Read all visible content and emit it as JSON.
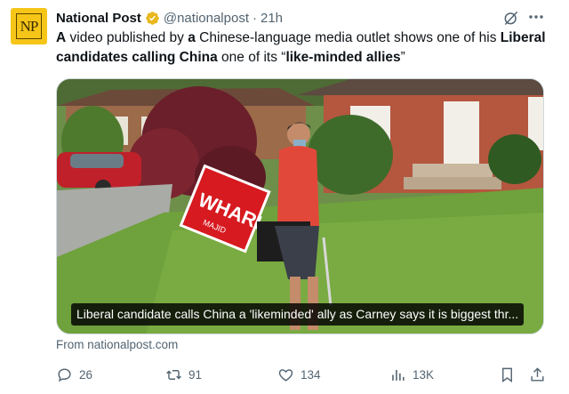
{
  "tweet": {
    "author": {
      "name": "National Post",
      "handle": "@nationalpost",
      "time": "21h",
      "avatar_text": "NP",
      "verified_color": "#e8b71a"
    },
    "text_parts": [
      {
        "t": "A",
        "bold": true
      },
      {
        "t": " video published by ",
        "bold": false
      },
      {
        "t": "a",
        "bold": true
      },
      {
        "t": " Chinese-language media outlet shows one of his ",
        "bold": false
      },
      {
        "t": "Liberal candidates calling China",
        "bold": true
      },
      {
        "t": " one of its “",
        "bold": false
      },
      {
        "t": "like-minded allies",
        "bold": true
      },
      {
        "t": "”",
        "bold": false
      }
    ],
    "media": {
      "caption": "Liberal candidate calls China a 'likeminded' ally as Carney says it is biggest thr...",
      "sign_text": "WHARI",
      "sign_subtext": "MAJID"
    },
    "source": "From nationalpost.com",
    "actions": {
      "replies": "26",
      "retweets": "91",
      "likes": "134",
      "views": "13K"
    },
    "icons": [
      "verified-icon",
      "grok-icon",
      "more-icon",
      "reply-icon",
      "retweet-icon",
      "like-icon",
      "views-icon",
      "bookmark-icon",
      "share-icon"
    ],
    "colors": {
      "text": "#0f1419",
      "muted": "#536471",
      "avatar_bg": "#f5c518",
      "sign_red": "#d71920"
    }
  }
}
